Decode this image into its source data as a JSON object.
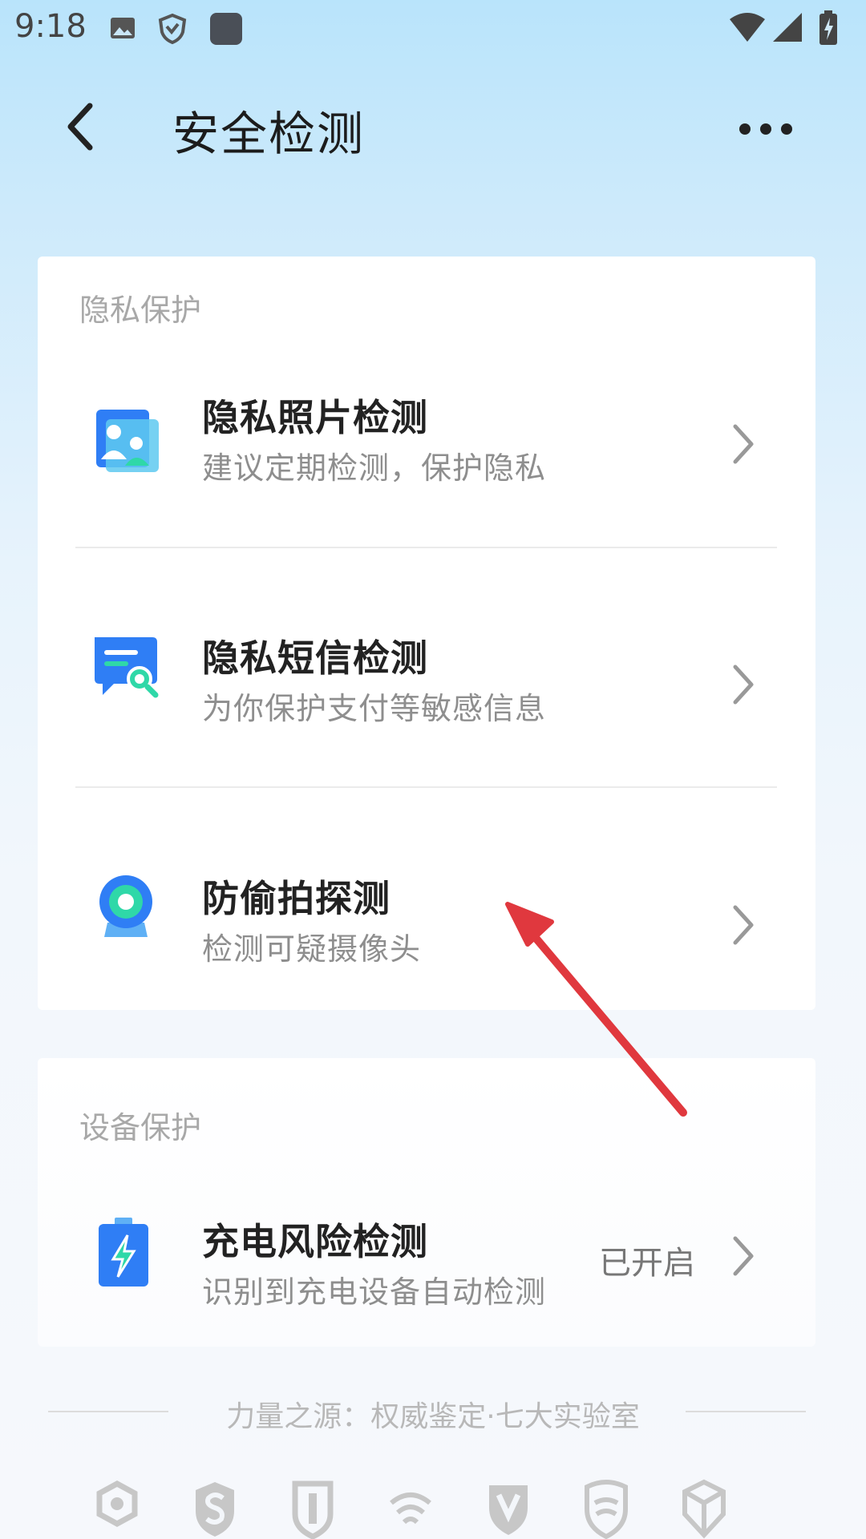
{
  "status_bar": {
    "time": "9:18",
    "left_icons": [
      "image-icon",
      "shield-icon",
      "app-square-icon"
    ],
    "right_icons": [
      "wifi-icon",
      "cellular-signal-icon",
      "battery-charging-icon"
    ]
  },
  "header": {
    "title": "安全检测",
    "back_icon": "back-arrow-icon",
    "more_icon": "more-dots-icon"
  },
  "privacy_section": {
    "title": "隐私保护",
    "items": [
      {
        "title": "隐私照片检测",
        "subtitle": "建议定期检测，保护隐私",
        "icon": "photo-privacy-icon"
      },
      {
        "title": "隐私短信检测",
        "subtitle": "为你保护支付等敏感信息",
        "icon": "sms-privacy-icon"
      },
      {
        "title": "防偷拍探测",
        "subtitle": "检测可疑摄像头",
        "icon": "camera-detect-icon"
      }
    ]
  },
  "device_section": {
    "title": "设备保护",
    "items": [
      {
        "title": "充电风险检测",
        "subtitle": "识别到充电设备自动检测",
        "status": "已开启",
        "icon": "charging-battery-icon"
      }
    ]
  },
  "footer": {
    "text": "力量之源：权威鉴定·七大实验室",
    "lab_logos": [
      "lab-logo-1-icon",
      "lab-logo-2-icon",
      "lab-logo-3-icon",
      "lab-logo-4-icon",
      "lab-logo-5-icon",
      "lab-logo-6-icon",
      "lab-logo-7-icon"
    ]
  },
  "colors": {
    "accent_blue": "#2f7ef5",
    "accent_green": "#2fd8a8",
    "annotation_red": "#e0383e"
  }
}
